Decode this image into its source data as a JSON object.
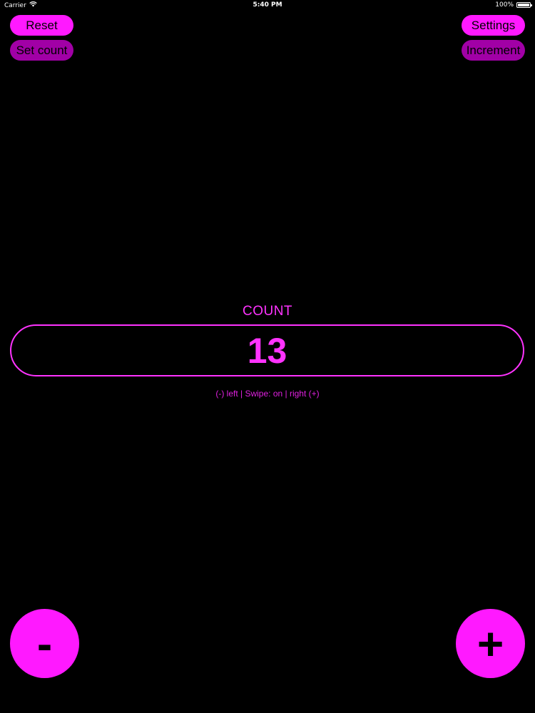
{
  "status_bar": {
    "carrier": "Carrier",
    "time": "5:40 PM",
    "battery": "100%",
    "battery_level": 1.0,
    "icons": [
      "wifi-icon",
      "battery-icon"
    ]
  },
  "toolbar": {
    "reset_label": "Reset",
    "set_count_label": "Set count",
    "settings_label": "Settings",
    "increment_label": "Increment"
  },
  "counter": {
    "label": "COUNT",
    "value": "13",
    "hint": "(-) left | Swipe: on | right (+)"
  },
  "controls": {
    "minus_label": "-",
    "plus_label": "+"
  },
  "colors": {
    "background": "#000000",
    "accent": "#ff19ff",
    "accent_dim": "#a100a6",
    "text_on_accent": "#000000"
  }
}
